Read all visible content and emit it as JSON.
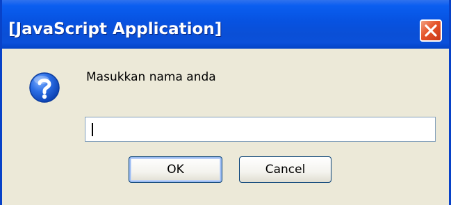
{
  "dialog": {
    "title": "[JavaScript Application]",
    "message": "Masukkan nama anda",
    "input": {
      "value": "",
      "placeholder": ""
    },
    "buttons": {
      "ok_label": "OK",
      "cancel_label": "Cancel"
    },
    "icons": {
      "prompt": "question-icon",
      "close": "close-icon"
    },
    "colors": {
      "titlebar": "#0752e0",
      "frame": "#0842c8",
      "body": "#ece9d8",
      "close_button": "#e5542a",
      "icon_blue": "#1a5fd8"
    }
  }
}
